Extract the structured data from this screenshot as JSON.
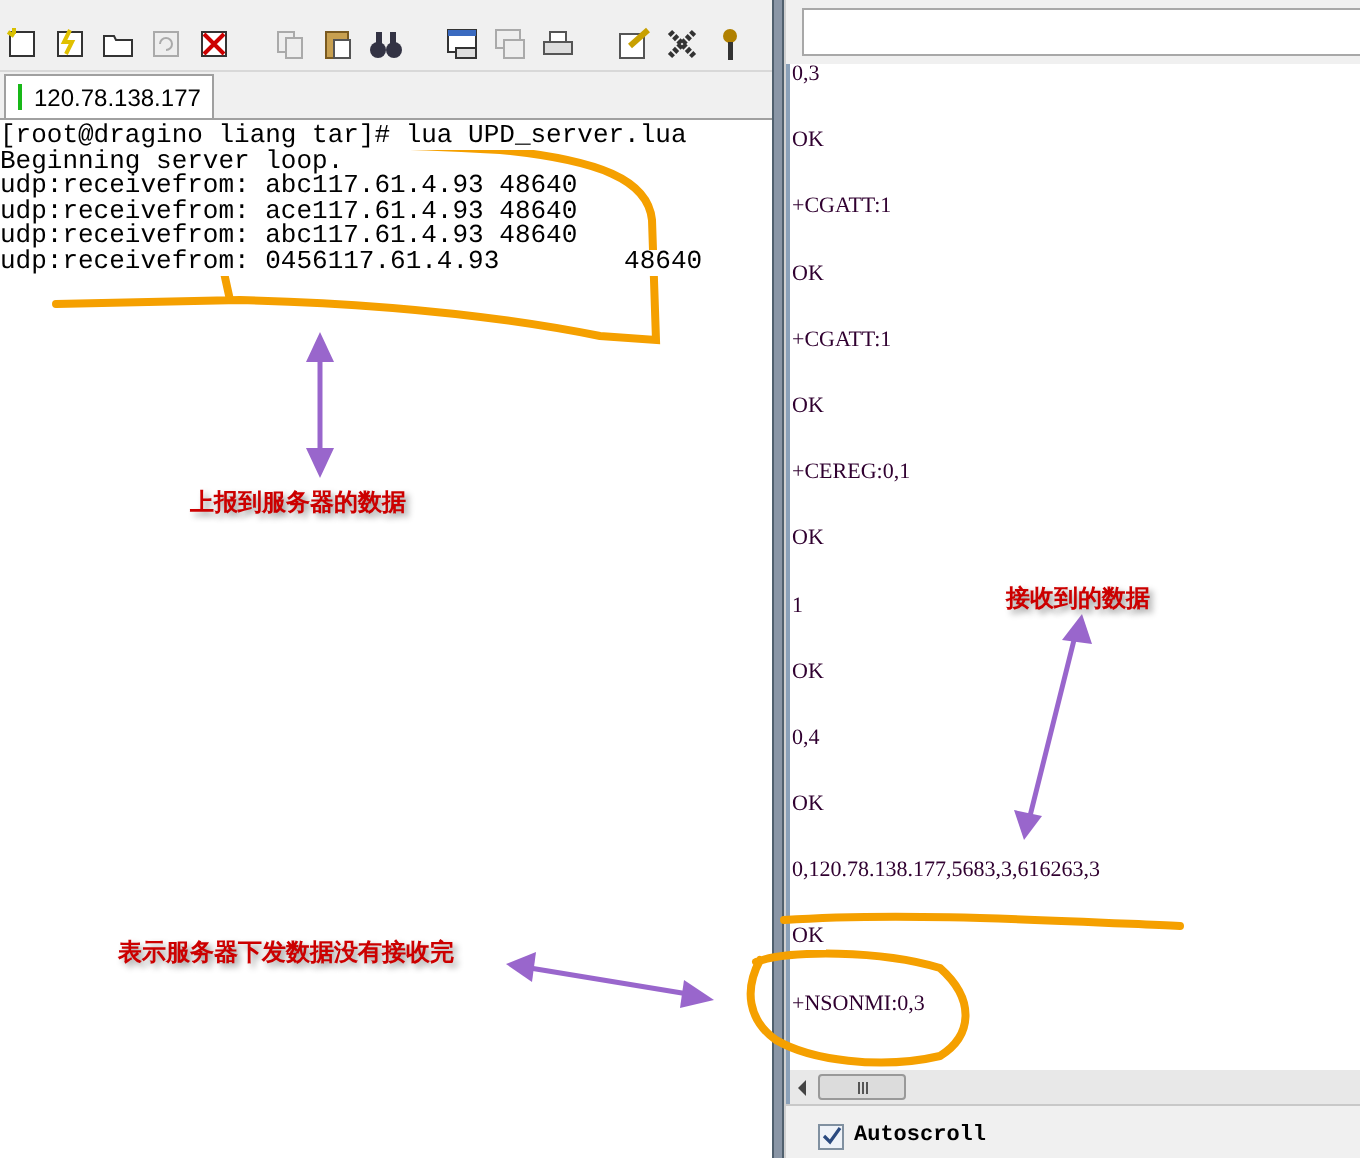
{
  "tabs": [
    {
      "label": "120.78.138.177",
      "selected": true
    }
  ],
  "terminal": {
    "lines": [
      "[root@dragino liang tar]# lua UPD_server.lua",
      "Beginning server loop.",
      "udp:receivefrom: abc117.61.4.93 48640",
      "udp:receivefrom: ace117.61.4.93 48640",
      "udp:receivefrom: abc117.61.4.93 48640",
      "udp:receivefrom: 0456117.61.4.93        48640"
    ]
  },
  "serial_log": {
    "lines": [
      "0,3",
      "OK",
      "+CGATT:1",
      "OK",
      "+CGATT:1",
      "OK",
      "+CEREG:0,1",
      "OK",
      "1",
      "OK",
      "0,4",
      "OK",
      "0,120.78.138.177,5683,3,616263,3",
      "OK",
      "+NSONMI:0,3"
    ]
  },
  "autoscroll": {
    "label": "Autoscroll",
    "checked": true
  },
  "annotations": [
    "上报到服务器的数据",
    "接收到的数据",
    "表示服务器下发数据没有接收完"
  ]
}
